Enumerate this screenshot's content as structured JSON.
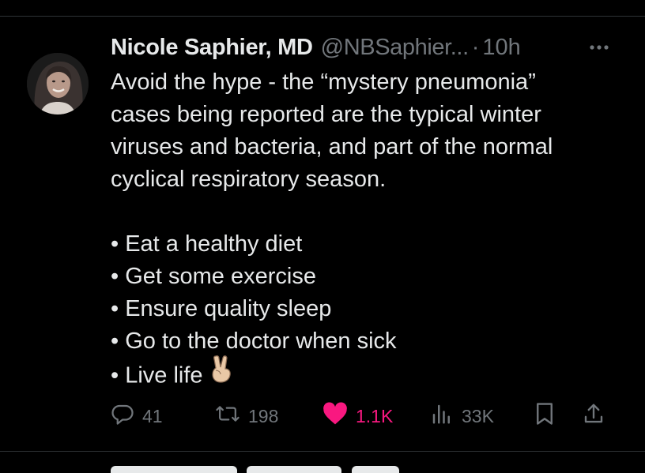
{
  "tweet": {
    "display_name": "Nicole Saphier, MD",
    "handle": "@NBSaphier...",
    "separator": "·",
    "time": "10h",
    "lines": [
      "Avoid the hype - the “mystery pneumonia”",
      "cases being reported are the typical winter",
      "viruses and bacteria, and part of the normal",
      "cyclical respiratory season."
    ],
    "bullets": [
      "• Eat a healthy diet",
      "• Get some exercise",
      "• Ensure quality sleep",
      "• Go to the doctor when sick",
      "• Live life"
    ],
    "emoji": "victory-hand-emoji",
    "actions": {
      "replies": "41",
      "reposts": "198",
      "likes": "1.1K",
      "views": "33K"
    }
  },
  "colors": {
    "background": "#000000",
    "text": "#e7e9ea",
    "muted": "#71767b",
    "like": "#f91880",
    "divider": "#2f3336"
  },
  "icons": [
    "reply-icon",
    "repost-icon",
    "like-heart-icon",
    "views-icon",
    "bookmark-icon",
    "share-icon",
    "more-icon"
  ]
}
